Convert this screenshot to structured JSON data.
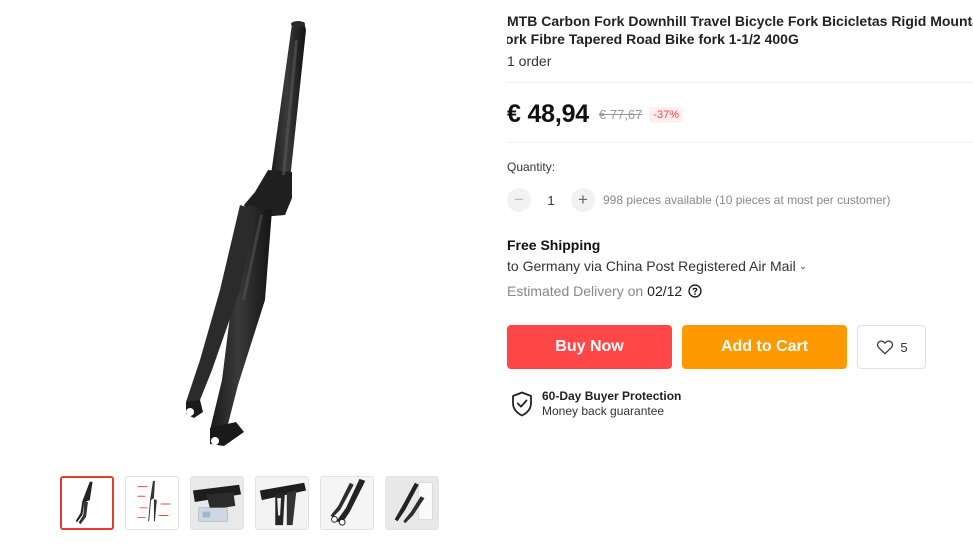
{
  "product": {
    "title_line1": "MTB Carbon Fork Downhill Travel Bicycle Fork Bicicletas Rigid Mountain F",
    "title_line2": "ork Fibre Tapered Road Bike fork 1-1/2 400G",
    "orders": "1 order"
  },
  "price": {
    "current": "€ 48,94",
    "original": "€ 77,67",
    "discount": "-37%"
  },
  "quantity": {
    "label": "Quantity:",
    "value": "1",
    "minus_symbol": "−",
    "plus_symbol": "+",
    "available": "998 pieces available (10 pieces at most per customer)"
  },
  "shipping": {
    "title": "Free Shipping",
    "destination": "to Germany via China Post Registered Air Mail",
    "estimated_label": "Estimated Delivery on",
    "estimated_date": "02/12"
  },
  "actions": {
    "buy_now": "Buy Now",
    "add_to_cart": "Add to Cart",
    "wishlist_count": "5"
  },
  "protection": {
    "title": "60-Day Buyer Protection",
    "subtitle": "Money back guarantee"
  },
  "gallery": {
    "thumbnails": [
      "fork-side-view",
      "fork-dimension-diagram",
      "fork-crown-closeup",
      "fork-closeup-angle",
      "fork-dropout-closeup",
      "fork-on-box"
    ],
    "active_index": 0
  },
  "colors": {
    "buy_now": "#ff4747",
    "add_to_cart": "#ff9900",
    "discount_text": "#ff4444",
    "active_thumb_border": "#e8392f"
  },
  "icons": {
    "chevron": "chevron-down-icon",
    "help": "question-circle-icon",
    "wishlist": "heart-icon",
    "protection": "shield-check-icon"
  }
}
